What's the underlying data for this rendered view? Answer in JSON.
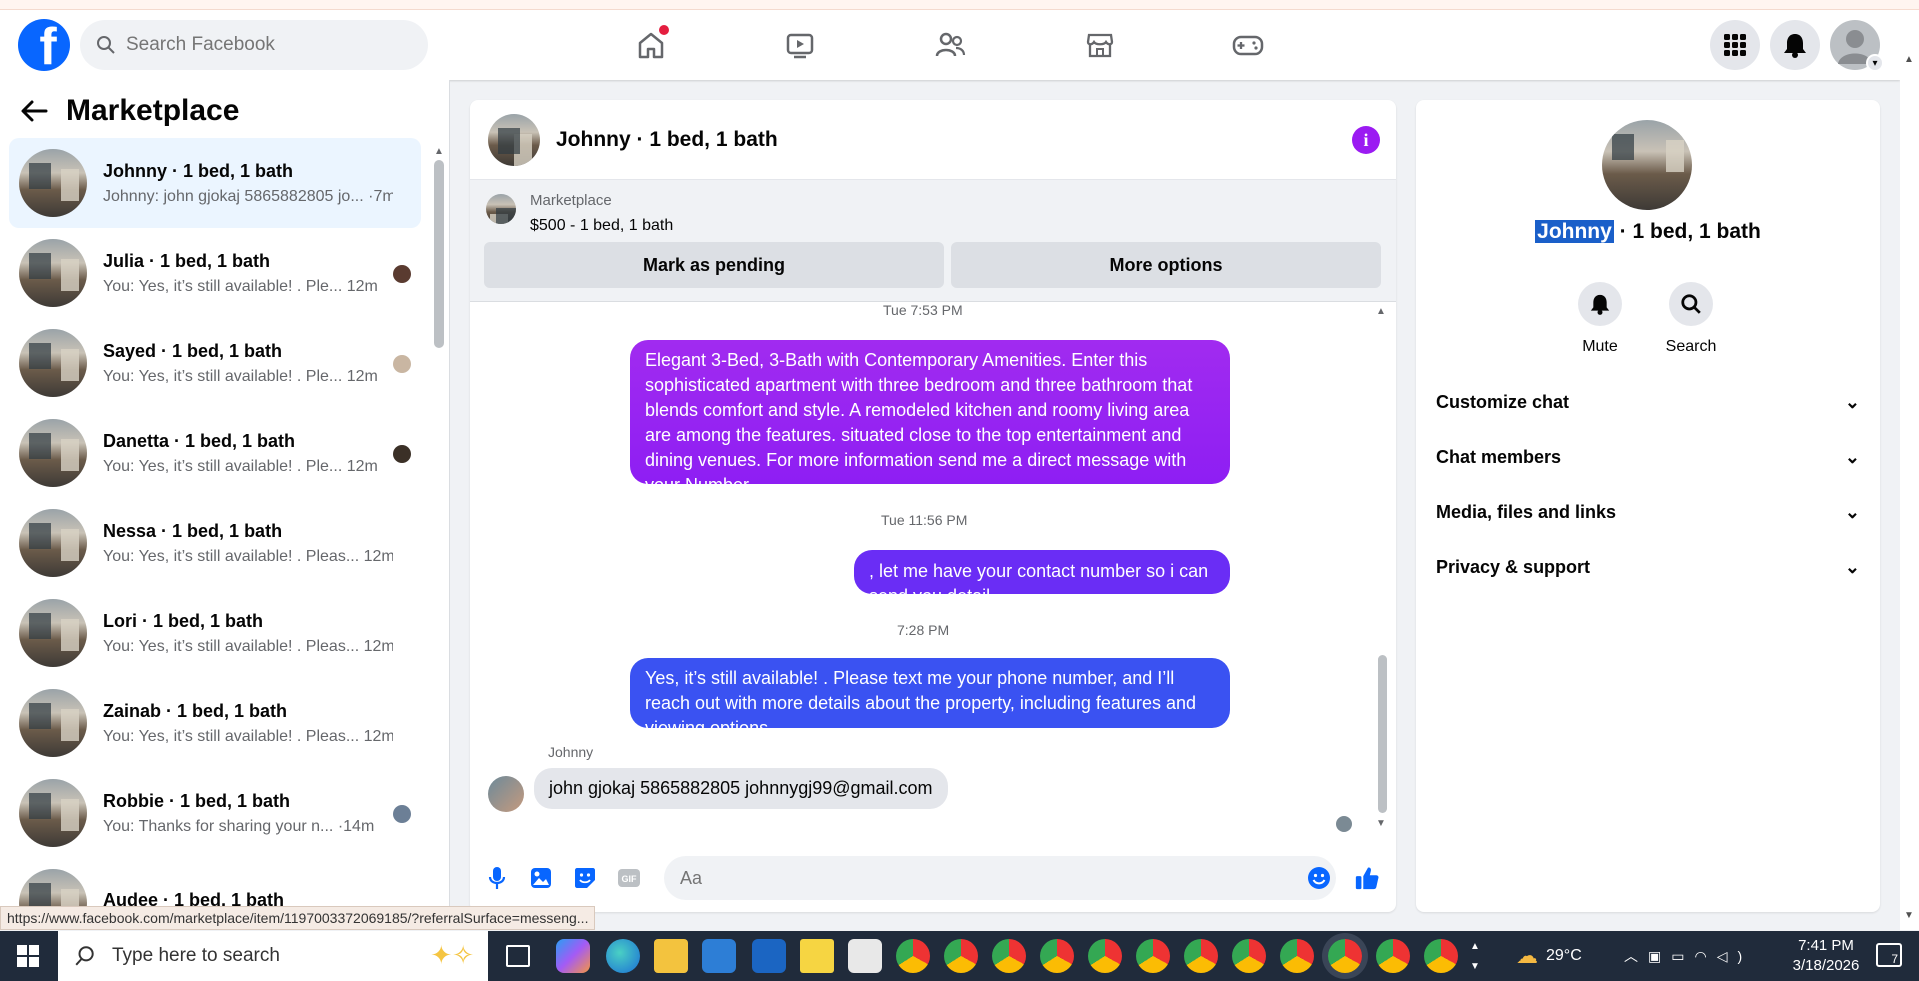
{
  "header": {
    "logo": "f",
    "search_placeholder": "Search Facebook",
    "nav_icons": [
      "home-icon",
      "video-icon",
      "friends-icon",
      "marketplace-icon",
      "gaming-icon"
    ],
    "right_icons": [
      "menu-grid-icon",
      "notifications-icon",
      "profile-avatar"
    ]
  },
  "sidebar": {
    "title": "Marketplace",
    "conversations": [
      {
        "name": "Johnny · 1 bed, 1 bath",
        "snippet": "Johnny: john gjokaj 5865882805 jo...",
        "time": "·7m"
      },
      {
        "name": "Julia · 1 bed, 1 bath",
        "snippet": "You: Yes, it’s still available! . Ple...",
        "time": "12m"
      },
      {
        "name": "Sayed · 1 bed, 1 bath",
        "snippet": "You: Yes, it’s still available! . Ple...",
        "time": "12m"
      },
      {
        "name": "Danetta · 1 bed, 1 bath",
        "snippet": "You: Yes, it’s still available! . Ple...",
        "time": "12m"
      },
      {
        "name": "Nessa · 1 bed, 1 bath",
        "snippet": "You: Yes, it’s still available! . Pleas...",
        "time": "12m"
      },
      {
        "name": "Lori · 1 bed, 1 bath",
        "snippet": "You: Yes, it’s still available! . Pleas...",
        "time": "12m"
      },
      {
        "name": "Zainab · 1 bed, 1 bath",
        "snippet": "You: Yes, it’s still available! . Pleas...",
        "time": "12m"
      },
      {
        "name": "Robbie · 1 bed, 1 bath",
        "snippet": "You: Thanks for sharing your n...",
        "time": "·14m"
      },
      {
        "name": "Audee · 1 bed, 1 bath",
        "snippet": "",
        "time": ""
      }
    ],
    "status_url": "https://www.facebook.com/marketplace/item/1197003372069185/?referralSurface=messeng..."
  },
  "chat": {
    "title": "Johnny · 1 bed, 1 bath",
    "listing": {
      "source": "Marketplace",
      "price_title": "$500 - 1 bed, 1 bath",
      "mark_pending": "Mark as pending",
      "more_options": "More options"
    },
    "timestamps": [
      "Tue 7:53 PM",
      "Tue 11:56 PM",
      "7:28 PM"
    ],
    "messages": [
      {
        "text": "Elegant 3-Bed, 3-Bath with Contemporary Amenities. Enter this sophisticated apartment with three bedroom and three bathroom that blends comfort and style. A remodeled kitchen and roomy living area are among the features. situated close to the top entertainment and dining venues. For more information send me a direct message with your Number."
      },
      {
        "text": ", let me have your contact number so i can send you detail"
      },
      {
        "text": "Yes, it’s still available! . Please text me your phone number, and I’ll reach out with more details about the property, including features and viewing options."
      }
    ],
    "incoming": {
      "sender": "Johnny",
      "text": "john gjokaj 5865882805 johnnygj99@gmail.com"
    },
    "composer_placeholder": "Aa"
  },
  "details": {
    "name_highlight": "Johnny",
    "name_rest": " · 1 bed, 1 bath",
    "actions": {
      "mute": "Mute",
      "search": "Search"
    },
    "sections": [
      "Customize chat",
      "Chat members",
      "Media, files and links",
      "Privacy & support"
    ]
  },
  "taskbar": {
    "search_placeholder": "Type here to search",
    "temperature": "29°C",
    "time": "7:41 PM",
    "date": "3/18/2026",
    "notification_count": "7"
  },
  "colors": {
    "brand": "#0866ff",
    "bubble_purple": "#9b1bf2",
    "bubble_violet": "#6a2df5",
    "bubble_blue": "#3a52f2"
  }
}
